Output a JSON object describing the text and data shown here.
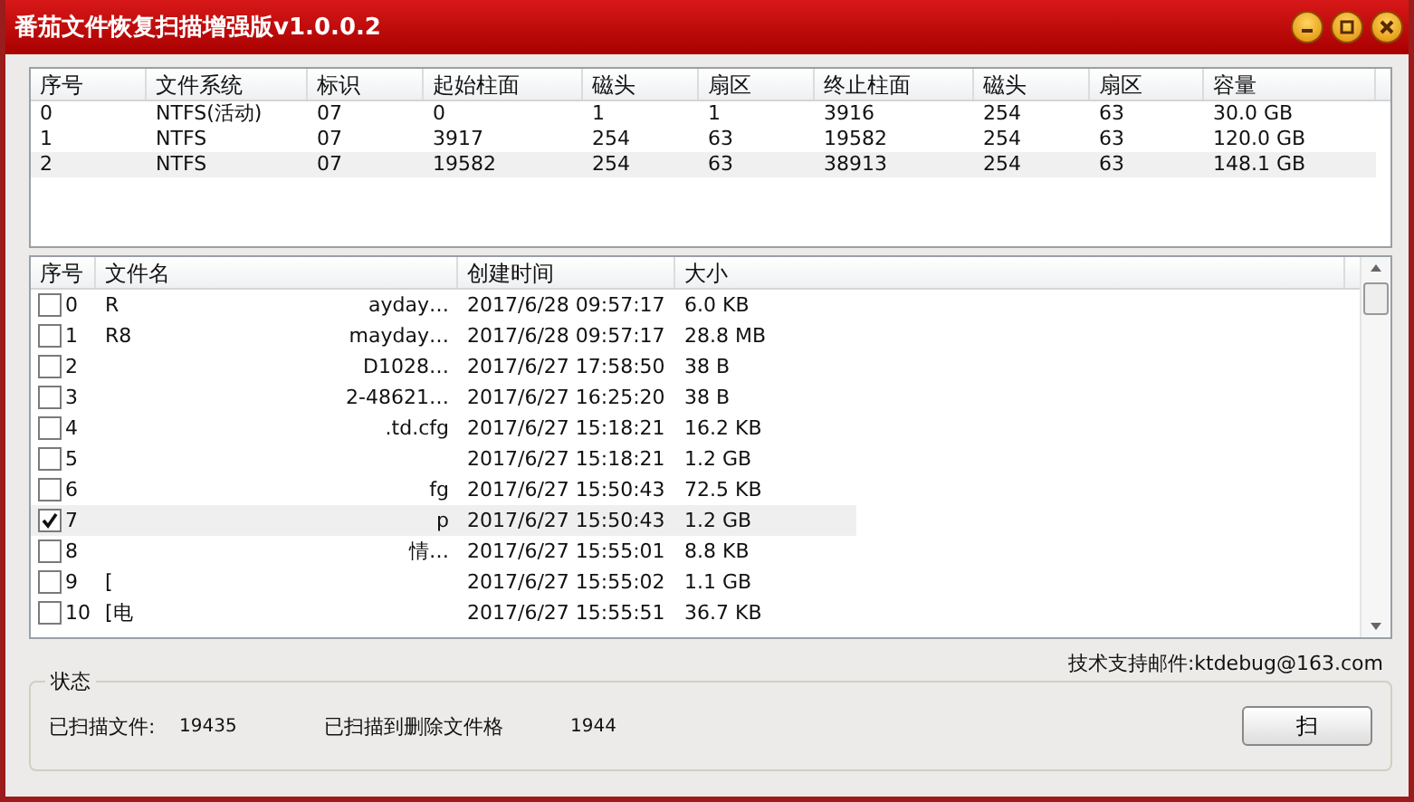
{
  "window": {
    "title": "番茄文件恢复扫描增强版v1.0.0.2"
  },
  "partitions": {
    "columns": [
      "序号",
      "文件系统",
      "标识",
      "起始柱面",
      "磁头",
      "扇区",
      "终止柱面",
      "磁头",
      "扇区",
      "容量"
    ],
    "rows": [
      {
        "cells": [
          "0",
          "NTFS(活动)",
          "07",
          "0",
          "1",
          "1",
          "3916",
          "254",
          "63",
          "30.0 GB"
        ],
        "selected": false
      },
      {
        "cells": [
          "1",
          "NTFS",
          "07",
          "3917",
          "254",
          "63",
          "19582",
          "254",
          "63",
          "120.0 GB"
        ],
        "selected": false
      },
      {
        "cells": [
          "2",
          "NTFS",
          "07",
          "19582",
          "254",
          "63",
          "38913",
          "254",
          "63",
          "148.1 GB"
        ],
        "selected": true
      }
    ]
  },
  "files": {
    "columns": [
      "序号",
      "文件名",
      "创建时间",
      "大小"
    ],
    "rows": [
      {
        "index": "0",
        "name": "R",
        "name_tail": "ayday…",
        "time": "2017/6/28 09:57:17",
        "size": "6.0 KB",
        "checked": false,
        "selected": false
      },
      {
        "index": "1",
        "name": "R8",
        "name_tail": "mayday…",
        "time": "2017/6/28 09:57:17",
        "size": "28.8 MB",
        "checked": false,
        "selected": false
      },
      {
        "index": "2",
        "name_tail": "D1028…",
        "time": "2017/6/27 17:58:50",
        "size": "38 B",
        "checked": false,
        "selected": false
      },
      {
        "index": "3",
        "name_tail": "2-48621…",
        "time": "2017/6/27 16:25:20",
        "size": "38 B",
        "checked": false,
        "selected": false
      },
      {
        "index": "4",
        "name_tail": ".td.cfg",
        "time": "2017/6/27 15:18:21",
        "size": "16.2 KB",
        "checked": false,
        "selected": false
      },
      {
        "index": "5",
        "time": "2017/6/27 15:18:21",
        "size": "1.2 GB",
        "checked": false,
        "selected": false
      },
      {
        "index": "6",
        "name_tail": "fg",
        "time": "2017/6/27 15:50:43",
        "size": "72.5 KB",
        "checked": false,
        "selected": false
      },
      {
        "index": "7",
        "name_tail": "p",
        "time": "2017/6/27 15:50:43",
        "size": "1.2 GB",
        "checked": true,
        "selected": true
      },
      {
        "index": "8",
        "name_tail": "情…",
        "time": "2017/6/27 15:55:01",
        "size": "8.8 KB",
        "checked": false,
        "selected": false
      },
      {
        "index": "9",
        "name": "[",
        "time": "2017/6/27 15:55:02",
        "size": "1.1 GB",
        "checked": false,
        "selected": false
      },
      {
        "index": "10",
        "name": "[电",
        "time": "2017/6/27 15:55:51",
        "size": "36.7 KB",
        "checked": false,
        "selected": false
      }
    ]
  },
  "support_email": "技术支持邮件:ktdebug@163.com",
  "status": {
    "title": "状态",
    "scanned_label": "已扫描文件:",
    "scanned_value": "19435",
    "deleted_label": "已扫描到删除文件格",
    "deleted_value": "1944"
  },
  "buttons": [
    {
      "label": "扫"
    }
  ]
}
